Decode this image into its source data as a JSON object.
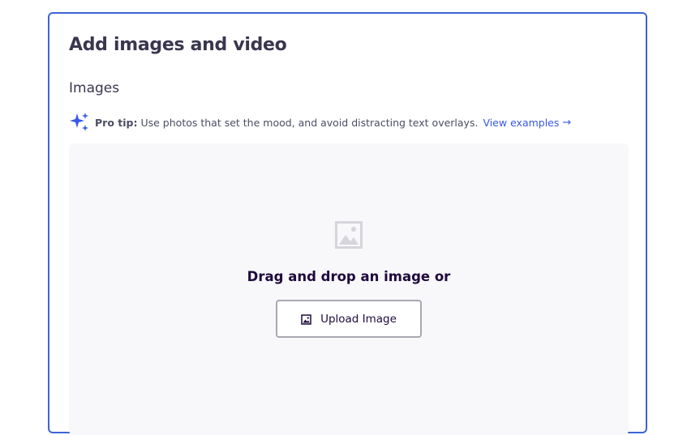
{
  "card": {
    "title": "Add images and video"
  },
  "images_section": {
    "title": "Images",
    "pro_tip": {
      "icon": "sparkles-icon",
      "label": "Pro tip:",
      "text": "Use photos that set the mood, and avoid distracting text overlays.",
      "link_label": "View examples",
      "link_arrow": "→"
    },
    "dropzone": {
      "placeholder_icon": "image-placeholder-icon",
      "prompt": "Drag and drop an image or",
      "upload_button": {
        "icon": "image-icon",
        "label": "Upload Image"
      }
    }
  },
  "colors": {
    "card_border": "#3d64d8",
    "accent_link": "#3659e3",
    "dropzone_bg": "#f8f7fa",
    "heading_text": "#39364f",
    "button_border": "#a9a8b3",
    "sparkle": "#3659e3"
  }
}
